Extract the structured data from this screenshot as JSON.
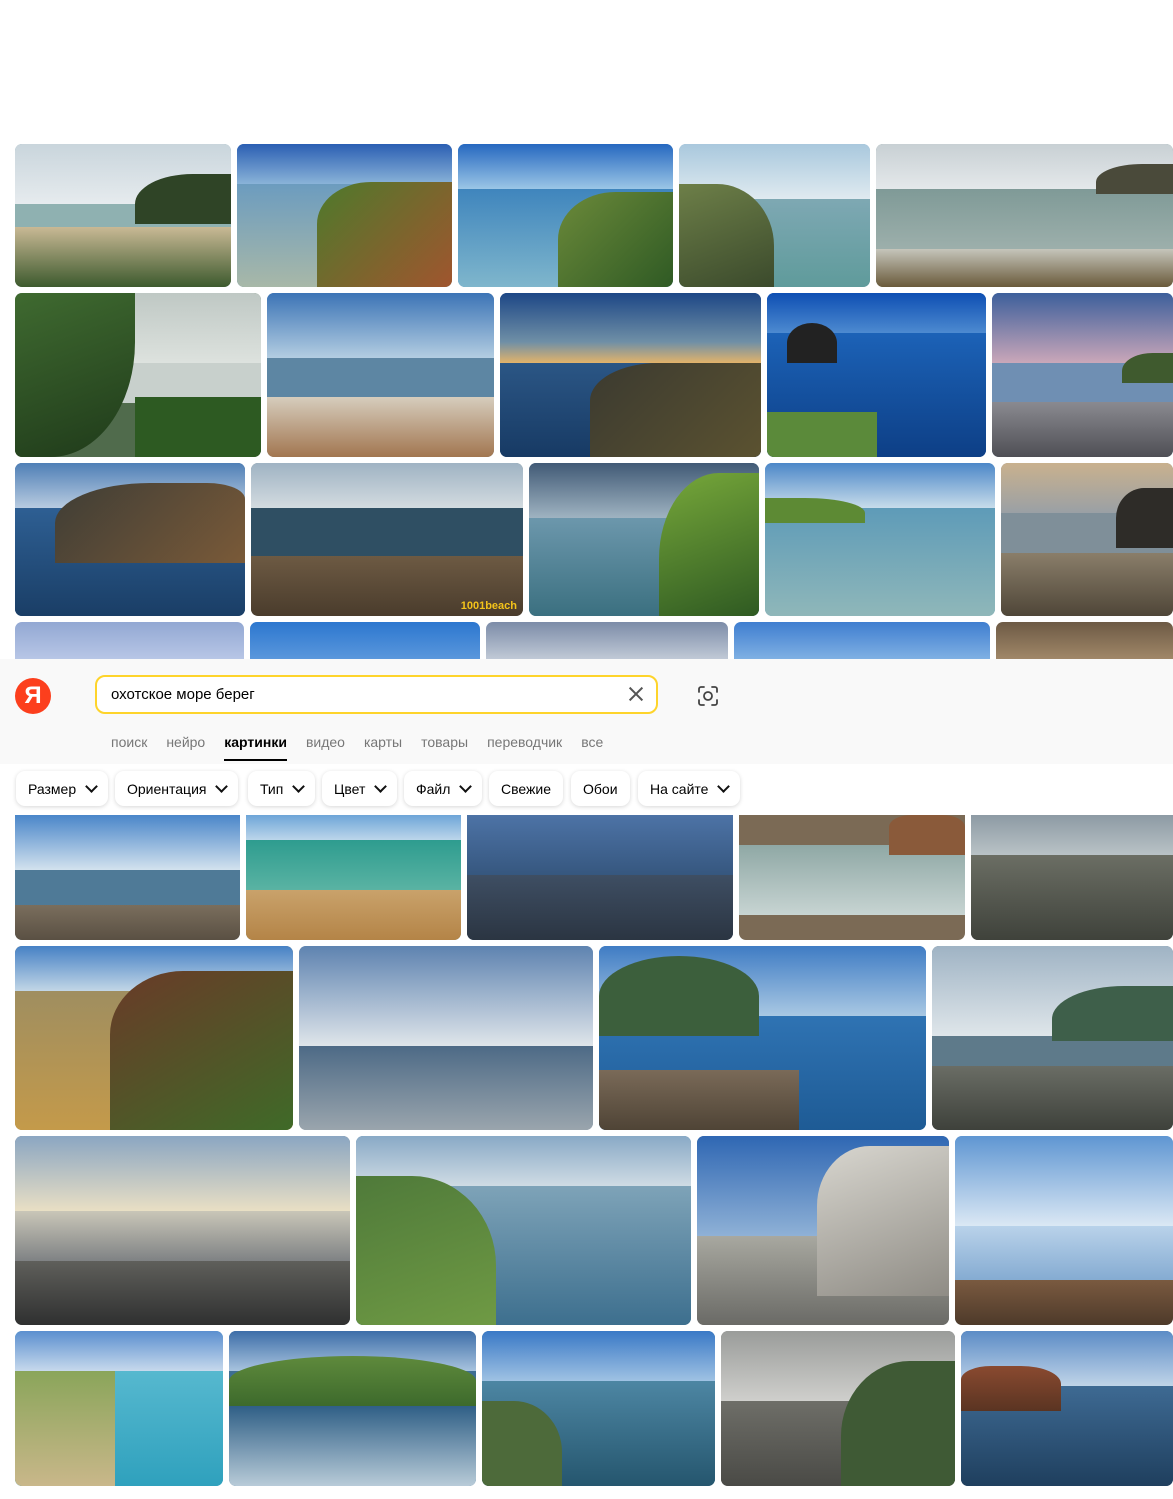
{
  "header": {
    "logo_letter": "Я",
    "search_value": "охотское море берег",
    "clear_icon": "close-icon",
    "camera_icon": "camera-search-icon"
  },
  "tabs": [
    {
      "label": "поиск",
      "active": false
    },
    {
      "label": "нейро",
      "active": false
    },
    {
      "label": "картинки",
      "active": true
    },
    {
      "label": "видео",
      "active": false
    },
    {
      "label": "карты",
      "active": false
    },
    {
      "label": "товары",
      "active": false
    },
    {
      "label": "переводчик",
      "active": false
    },
    {
      "label": "все",
      "active": false
    }
  ],
  "filters": [
    {
      "label": "Размер",
      "dropdown": true
    },
    {
      "label": "Ориентация",
      "dropdown": true
    },
    {
      "label": "Тип",
      "dropdown": true
    },
    {
      "label": "Цвет",
      "dropdown": true
    },
    {
      "label": "Файл",
      "dropdown": true
    },
    {
      "label": "Свежие",
      "dropdown": false
    },
    {
      "label": "Обои",
      "dropdown": false
    },
    {
      "label": "На сайте",
      "dropdown": true
    }
  ],
  "results": {
    "watermark_1001": "1001beach"
  },
  "colors": {
    "brand_red": "#fc3f1d",
    "search_border": "#fed42b"
  }
}
